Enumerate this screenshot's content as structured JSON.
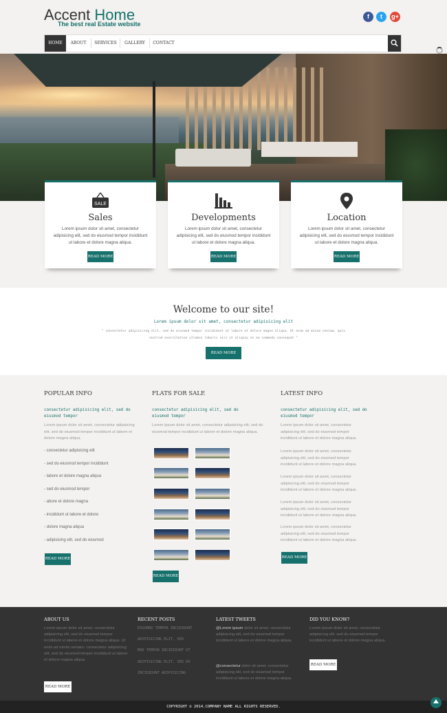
{
  "header": {
    "logo_accent": "Accent",
    "logo_home": "Home",
    "tagline": "The best real Estate website",
    "social": {
      "facebook": "f",
      "twitter": "t",
      "googleplus": "g+"
    }
  },
  "nav": [
    "HOME",
    "ABOUT",
    "SERVICES",
    "GALLERY",
    "CONTACT"
  ],
  "features": [
    {
      "icon": "sale-sign-icon",
      "badge": "SALE",
      "title": "Sales",
      "text": "Lorem ipsum dolor sit amet, consectetur adipisicing elit, sed do eiusmod tempor incididunt ut labore et dolore magna aliqua.",
      "button": "READ MORE"
    },
    {
      "icon": "bar-chart-icon",
      "title": "Developments",
      "text": "Lorem ipsum dolor sit amet, consectetur adipisicing elit, sed do eiusmod tempor incididunt ut labore et dolore magna aliqua.",
      "button": "READ MORE"
    },
    {
      "icon": "map-pin-icon",
      "title": "Location",
      "text": "Lorem ipsum dolor sit amet, consectetur adipisicing elit, sed do eiusmod tempor incididunt ut labore et dolore magna aliqua.",
      "button": "READ MORE"
    }
  ],
  "welcome": {
    "title": "Welcome to our site!",
    "subtitle": "Lorem ipsum dolor sit amet, consectetur adipisicing elit",
    "text": "\" consectetur adipisicing elit, sed do eiusmod tempor incididunt ut labore et dolore magna aliqua. Ut enim ad minim veniam, quis nostrud exercitation ullamco laboris nisi ut aliquip ex ea commodo consequat \"",
    "button": "READ MORE"
  },
  "popular": {
    "title": "POPULAR INFO",
    "subtitle": "consectetur adipisicing elit, sed do eiusmod tempor",
    "text": "Lorem ipsum dolor sit amet, consectetur adipisicing elit, sed do eiusmod tempor incididunt ut labore et dolore magna aliqua.",
    "items": [
      "- consectetur adipisicing elit",
      "- sed do eiusmod tempor incididunt",
      "- labore et dolore magna aliqua",
      "- sed do eiusmod tempor",
      "- abore et dolore magna",
      "- incididunt ut labore et dolore",
      "- dolore magna aliqua",
      "- adipisicing elit, sed do eiusmod"
    ],
    "button": "READ MORE"
  },
  "flats": {
    "title": "FLATS FOR SALE",
    "subtitle": "consectetur adipisicing elit, sed do eiusmod tempor",
    "text": "Lorem ipsum dolor sit amet, consectetur adipisicing elit, sed do eiusmod tempor incididunt ut labore et dolore magna aliqua.",
    "button": "READ MORE"
  },
  "latest": {
    "title": "LATEST INFO",
    "subtitle": "consectetur adipisicing elit, sed do eiusmod tempor",
    "paragraphs": [
      "Lorem ipsum dolor sit amet, consectetur adipisicing elit, sed do eiusmod tempor incididunt ut labore et dolore magna aliqua.",
      "Lorem ipsum dolor sit amet, consectetur adipisicing elit, sed do eiusmod tempor incididunt ut labore et dolore magna aliqua.",
      "Lorem ipsum dolor sit amet, consectetur adipisicing elit, sed do eiusmod tempor incididunt ut labore et dolore magna aliqua.",
      "Lorem ipsum dolor sit amet, consectetur adipisicing elit, sed do eiusmod tempor incididunt ut labore et dolore magna aliqua.",
      "Lorem ipsum dolor sit amet, consectetur adipisicing elit, sed do eiusmod tempor incididunt ut labore et dolore magna aliqua."
    ],
    "button": "READ MORE"
  },
  "footer": {
    "about": {
      "title": "ABOUT US",
      "text": "Lorem ipsum dolor sit amet, consectetur adipisicing elit, sed do eiusmod tempor incididunt ut labore et dolore magna aliqua. Ut enim ad minim veniam. consectetur adipisicing elit, sed do eiusmod tempor incididunt ut labore et dolore magna aliqua.",
      "button": "READ MORE"
    },
    "recent": {
      "title": "RECENT POSTS",
      "items": [
        "EIUSMOD TEMPOR INCIDIDUNT",
        "ADIPISICING ELIT, SED",
        "MOD TEMPOR INCIDIDUNT UT",
        "ADIPISICING ELIT, SED DO",
        "INCIDIDUNT ADIPISICING"
      ]
    },
    "tweets": {
      "title": "LATEST TWEETS",
      "tweet1_handle": "@Lorem ipsum",
      "tweet1_text": "dolor sit amet, consectetur adipisicing elit, sed do eiusmod tempor incididunt ut labore et dolore magna aliqua.",
      "tweet2_handle": "@consectetur",
      "tweet2_text": "dolor sit amet, consectetur adipisicing elit, sed do eiusmod tempor incididunt ut labore et dolore magna aliqua."
    },
    "know": {
      "title": "DID YOU KNOW?",
      "text": "Lorem ipsum dolor sit amet, consectetur adipisicing elit, sed do eiusmod tempor incididunt ut labore et dolore magna aliqua.",
      "button": "READ MORE"
    }
  },
  "copyright": "COPYRIGHT © 2014.COMPANY NAME ALL RIGHTS RESERVED.",
  "colors": {
    "accent": "#16706b",
    "dark": "#333333",
    "background": "#f3f2f0"
  }
}
